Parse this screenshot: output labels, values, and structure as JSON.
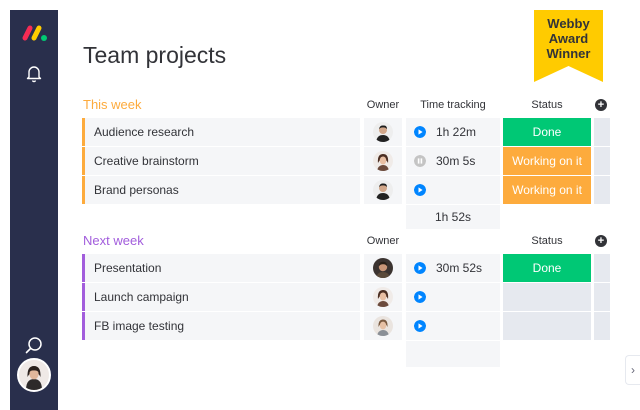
{
  "page_title": "Team projects",
  "badge": {
    "line1": "Webby",
    "line2": "Award",
    "line3": "Winner",
    "color": "#ffcb00"
  },
  "sidebar": {
    "icons": [
      "monday-logo-icon",
      "bell-icon",
      "search-icon"
    ],
    "bg_color": "#292f4c"
  },
  "scroll_tab_glyph": "›",
  "colors": {
    "done": "#00c875",
    "working": "#fdab3d",
    "empty": "#e6e9ef",
    "this_week": "#fdab3d",
    "next_week": "#a25ddc",
    "play": "#0085ff",
    "pause": "#c4c4c4"
  },
  "groups": [
    {
      "title": "This week",
      "columns": {
        "owner": "Owner",
        "time": "Time tracking",
        "status": "Status"
      },
      "rows": [
        {
          "name": "Audience research",
          "time": "1h 22m",
          "timer": "play",
          "status": "Done"
        },
        {
          "name": "Creative brainstorm",
          "time": "30m 5s",
          "timer": "pause",
          "status": "Working on it"
        },
        {
          "name": "Brand personas",
          "time": "",
          "timer": "play",
          "status": "Working on it"
        }
      ],
      "time_total": "1h 52s"
    },
    {
      "title": "Next week",
      "columns": {
        "owner": "Owner",
        "time": "",
        "status": "Status"
      },
      "rows": [
        {
          "name": "Presentation",
          "time": "30m 52s",
          "timer": "play",
          "status": "Done"
        },
        {
          "name": "Launch campaign",
          "time": "",
          "timer": "play",
          "status": ""
        },
        {
          "name": "FB image testing",
          "time": "",
          "timer": "play",
          "status": ""
        }
      ],
      "time_total": ""
    }
  ]
}
